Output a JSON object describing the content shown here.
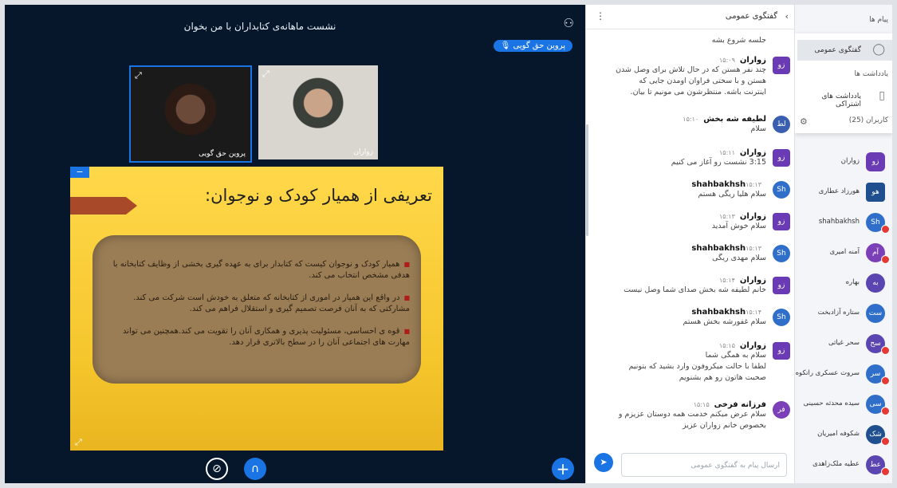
{
  "meeting": {
    "title": "نشست ماهانه‌ی کتابداران با من بخوان",
    "presenter": "پروین حق گویی",
    "users_icon": "users-icon"
  },
  "cams": [
    {
      "name": "پروین حق گویی"
    },
    {
      "name": "زواران"
    }
  ],
  "slide": {
    "title": "تعریفی از همیار کودک و نوجوان:",
    "bullets": [
      "همیار کودک و نوجوان کیست که کتابدار برای به عهده گیری بخشی از وظایف کتابخانه با هدفی مشخص انتخاب می کند.",
      "در واقع این همیار در اموری از کتابخانه که متعلق به خودش است شرکت می کند. مشارکتی که به آنان فرصت تصمیم گیری و استقلال فراهم می کند.",
      "قوه ی احساسی، مسئولیت پذیری و همکاری آنان را تقویت می کند.همچنین می تواند مهارت های اجتماعی آنان را در سطح بالاتری قرار دهد."
    ]
  },
  "chat": {
    "title": "گفتگوی عمومی",
    "top_line": "جلسه شروع بشه",
    "messages": [
      {
        "avatar": "زو",
        "color": "#6a3bb5",
        "name": "زواران",
        "time": "۱۵:۰۹",
        "lines": [
          "چند نفر هستن که در حال تلاش برای وصل شدن",
          "هستن و با سختی فراوان اومدن جایی که",
          "اینترنت باشه. منتظرشون می مونیم تا بیان."
        ]
      },
      {
        "avatar": "لط",
        "color": "#3a5fb0",
        "name": "لطیفه شه بخش",
        "time": "۱۵:۱۰",
        "lines": [
          "سلام"
        ]
      },
      {
        "avatar": "زو",
        "color": "#6a3bb5",
        "name": "زواران",
        "time": "۱۵:۱۱",
        "lines": [
          "3:15 نشست رو آغاز می کنیم"
        ]
      },
      {
        "avatar": "Sh",
        "color": "#2f6fc9",
        "name": "shahbakhsh",
        "time": "۱۵:۱۳",
        "lines": [
          "سلام هلیا ریگی هستم"
        ]
      },
      {
        "avatar": "زو",
        "color": "#6a3bb5",
        "name": "زواران",
        "time": "۱۵:۱۳",
        "lines": [
          "سلام خوش آمدید"
        ]
      },
      {
        "avatar": "Sh",
        "color": "#2f6fc9",
        "name": "shahbakhsh",
        "time": "۱۵:۱۳",
        "lines": [
          "سلام مهدی ریگی"
        ]
      },
      {
        "avatar": "زو",
        "color": "#6a3bb5",
        "name": "زواران",
        "time": "۱۵:۱۴",
        "lines": [
          "خانم لطیفه شه بخش صدای شما وصل نیست"
        ]
      },
      {
        "avatar": "Sh",
        "color": "#2f6fc9",
        "name": "shahbakhsh",
        "time": "۱۵:۱۴",
        "lines": [
          "سلام غفورشه بخش هستم"
        ]
      },
      {
        "avatar": "زو",
        "color": "#6a3bb5",
        "name": "زواران",
        "time": "۱۵:۱۵",
        "lines": [
          "سلام به همگی شما",
          "لطفا با حالت میکروفون وارد بشید که بتونیم",
          "صحبت هاتون رو هم بشنویم"
        ]
      },
      {
        "avatar": "فر",
        "color": "#7b3fb8",
        "name": "فرزانه فرخی",
        "time": "۱۵:۱۵",
        "lines": [
          "سلام عرض میکنم خدمت همه دوستان عزیزم و",
          "بخصوص خانم زواران عزیز"
        ]
      }
    ],
    "input_placeholder": "ارسال پیام به گفتگوی عمومی"
  },
  "sidebar": {
    "messages_header": "پیام ها",
    "public_chat": "گفتگوی عمومی",
    "notes_header": "یادداشت ها",
    "shared_notes": "یادداشت های اشتراکی",
    "users_header": "کاربران (25)",
    "users": [
      {
        "av": "زو",
        "name": "زواران",
        "color": "#6a3bb5"
      },
      {
        "av": "هو",
        "name": "هورزاد عطاری",
        "color": "#1f4f8f"
      },
      {
        "av": "Sh",
        "name": "shahbakhsh",
        "color": "#2f6fc9"
      },
      {
        "av": "آم",
        "name": "آمنه امیری",
        "color": "#7b3fb8"
      },
      {
        "av": "به",
        "name": "بهاره",
        "color": "#5b45b0"
      },
      {
        "av": "ست",
        "name": "ستاره آزادبخت",
        "color": "#2f6fc9"
      },
      {
        "av": "سح",
        "name": "سحر غیاثی",
        "color": "#5b45b0"
      },
      {
        "av": "سر",
        "name": "سروت عسکری راتکوه...",
        "color": "#2f6fc9"
      },
      {
        "av": "سی",
        "name": "سیده محدثه حسینی",
        "color": "#2f6fc9"
      },
      {
        "av": "شک",
        "name": "شکوفه امیریان",
        "color": "#1f4f8f"
      },
      {
        "av": "عط",
        "name": "عطیه ملک‌زاهدی",
        "color": "#5b45b0"
      }
    ]
  }
}
